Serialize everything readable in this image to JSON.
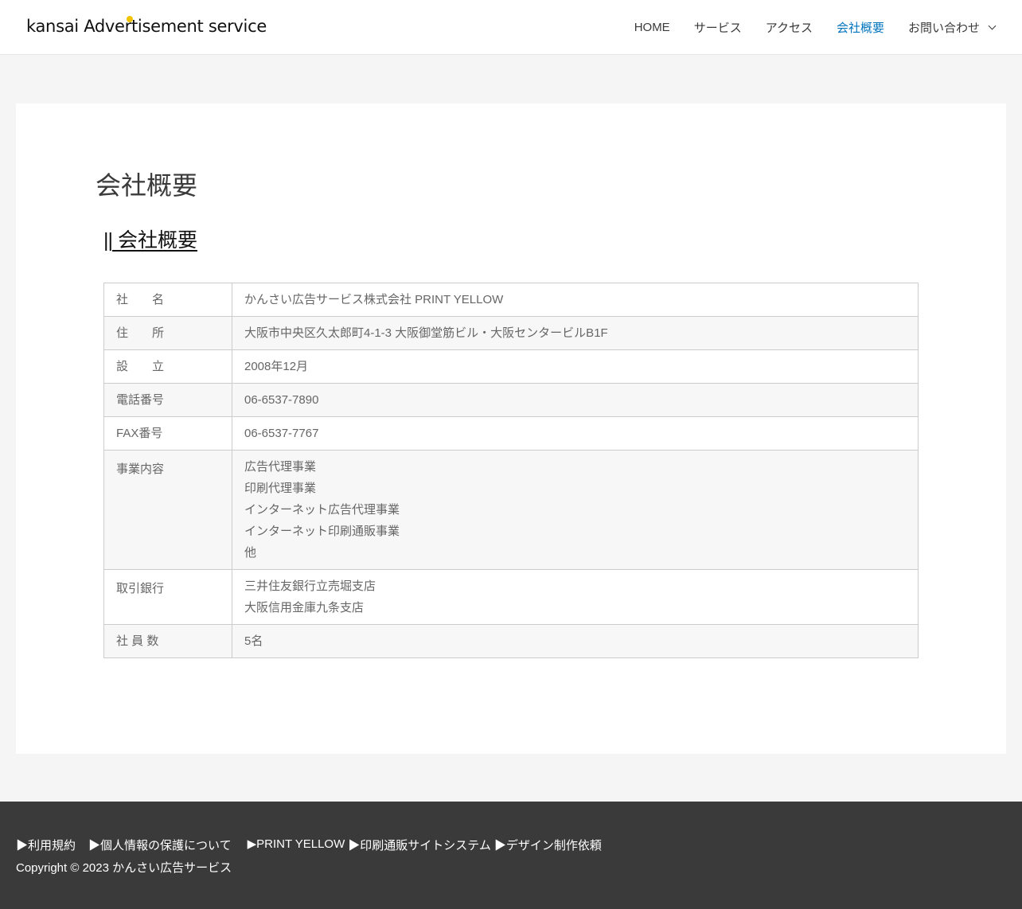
{
  "header": {
    "logo_text": "kansai Advertisement service",
    "nav": [
      {
        "label": "HOME"
      },
      {
        "label": "サービス"
      },
      {
        "label": "アクセス"
      },
      {
        "label": "会社概要"
      },
      {
        "label": "お問い合わせ"
      }
    ],
    "active_color": "#0274be"
  },
  "main": {
    "page_title": "会社概要",
    "section_heading_bars": "||",
    "section_heading": "会社概要",
    "rows": [
      {
        "label": "社　　名",
        "values": [
          "かんさい広告サービス株式会社 PRINT YELLOW"
        ]
      },
      {
        "label": "住　　所",
        "values": [
          "大阪市中央区久太郎町4-1-3 大阪御堂筋ビル・大阪センタービルB1F"
        ]
      },
      {
        "label": "設　　立",
        "values": [
          "2008年12月"
        ]
      },
      {
        "label": "電話番号",
        "values": [
          "06-6537-7890"
        ]
      },
      {
        "label": "FAX番号",
        "values": [
          "06-6537-7767"
        ]
      },
      {
        "label": "事業内容",
        "values": [
          "広告代理事業",
          "印刷代理事業",
          "インターネット広告代理事業",
          "インターネット印刷通販事業",
          "他"
        ]
      },
      {
        "label": "取引銀行",
        "values": [
          "三井住友銀行立売堀支店",
          "大阪信用金庫九条支店"
        ]
      },
      {
        "label": "社 員 数",
        "values": [
          "5名"
        ]
      }
    ]
  },
  "footer": {
    "links": [
      {
        "label": "▶利用規約"
      },
      {
        "label": "▶個人情報の保護について"
      },
      {
        "label": "▶PRINT YELLOW"
      },
      {
        "label": "▶印刷通販サイトシステム"
      },
      {
        "label": "▶デザイン制作依頼"
      }
    ],
    "copyright": "Copyright © 2023 かんさい広告サービス",
    "background": "#3a3a3a"
  }
}
